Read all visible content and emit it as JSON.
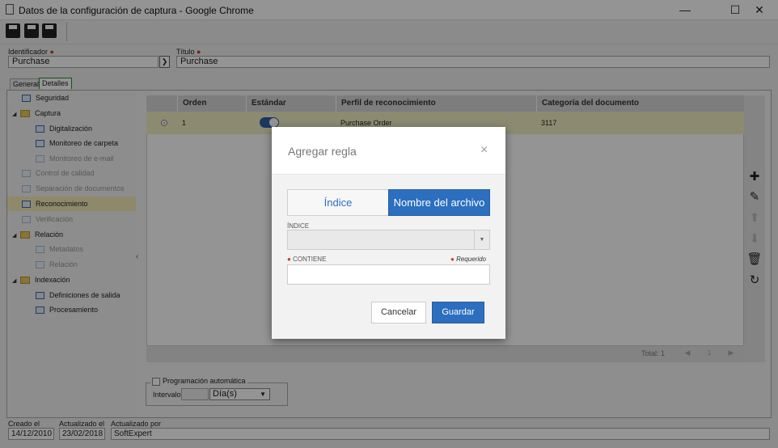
{
  "window": {
    "title": "Datos de la configuración de captura - Google Chrome",
    "minimize": "—",
    "maximize": "☐",
    "close": "✕"
  },
  "form": {
    "identificador_label": "Identificador",
    "identificador_value": "Purchase",
    "titulo_label": "Título",
    "titulo_value": "Purchase",
    "nav_arrow": "❯"
  },
  "tabs": [
    {
      "label": "General"
    },
    {
      "label": "Detalles"
    }
  ],
  "tree": {
    "items": [
      {
        "label": "Seguridad"
      },
      {
        "label": "Captura",
        "expander": "◢"
      },
      {
        "label": "Digitalización"
      },
      {
        "label": "Monitoreo de carpeta"
      },
      {
        "label": "Monitoreo de e-mail"
      },
      {
        "label": "Control de calidad"
      },
      {
        "label": "Separación de documentos"
      },
      {
        "label": "Reconocimiento"
      },
      {
        "label": "Verificación"
      },
      {
        "label": "Relación",
        "expander": "◢"
      },
      {
        "label": "Metadatos"
      },
      {
        "label": "Relación"
      },
      {
        "label": "Indexación",
        "expander": "◢"
      },
      {
        "label": "Definiciones de salida"
      },
      {
        "label": "Procesamiento"
      }
    ],
    "collapse": "‹"
  },
  "grid": {
    "columns": [
      "Orden",
      "Estándar",
      "Perfil de reconocimiento",
      "Categoría del documento"
    ],
    "rows": [
      {
        "orden": "1",
        "perfil": "Purchase Order",
        "categoria": "3117"
      }
    ],
    "footer_total": "Total: 1",
    "pager": [
      "◀",
      "1",
      "▶"
    ]
  },
  "actions": {
    "add": "✚",
    "edit": "✎",
    "up": "⬆",
    "down": "⬇",
    "delete": "🗑",
    "refresh": "↻"
  },
  "schedule": {
    "legend": "Programación automática",
    "interval_label": "Intervalo",
    "unit_value": "Día(s)",
    "unit_caret": "▼"
  },
  "footer": {
    "created_label": "Creado el",
    "created_value": "14/12/2010",
    "updated_label": "Actualizado el",
    "updated_value": "23/02/2018",
    "updated_by_label": "Actualizado por",
    "updated_by_value": "SoftExpert"
  },
  "modal": {
    "title": "Agregar regla",
    "close": "×",
    "seg_indice": "Índice",
    "seg_nombre": "Nombre del archivo",
    "indice_label": "ÍNDICE",
    "indice_caret": "▼",
    "contiene_label": "CONTIENE",
    "req_dot": "●",
    "requerido": "Requerido",
    "cancel": "Cancelar",
    "save": "Guardar"
  },
  "colors": {
    "accent": "#2c6fbe",
    "selected_row": "#f1efc3",
    "required": "#d33333"
  }
}
